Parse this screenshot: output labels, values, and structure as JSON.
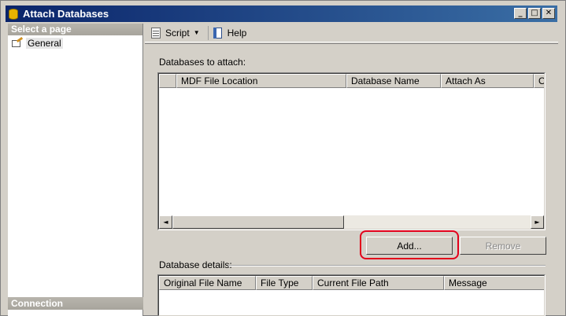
{
  "window": {
    "title": "Attach Databases",
    "controls": [
      "_",
      "□",
      "✕"
    ]
  },
  "left_pane": {
    "header": "Select a page",
    "pages": [
      {
        "label": "General",
        "icon": "general-page-icon"
      }
    ],
    "connection_header": "Connection"
  },
  "toolbar": {
    "script_label": "Script",
    "dropdown_glyph": "▼",
    "help_label": "Help"
  },
  "attach": {
    "label": "Databases to attach:",
    "columns": [
      "",
      "MDF File Location",
      "Database Name",
      "Attach As",
      "Ov"
    ],
    "scroll_left": "◄",
    "scroll_right": "►"
  },
  "buttons": {
    "add": "Add...",
    "remove": "Remove"
  },
  "details": {
    "label": "Database details:",
    "columns": [
      "Original File Name",
      "File Type",
      "Current File Path",
      "Message"
    ]
  },
  "colors": {
    "title_start": "#0a246a",
    "title_end": "#3a6ea5",
    "highlight": "#e3001b"
  }
}
